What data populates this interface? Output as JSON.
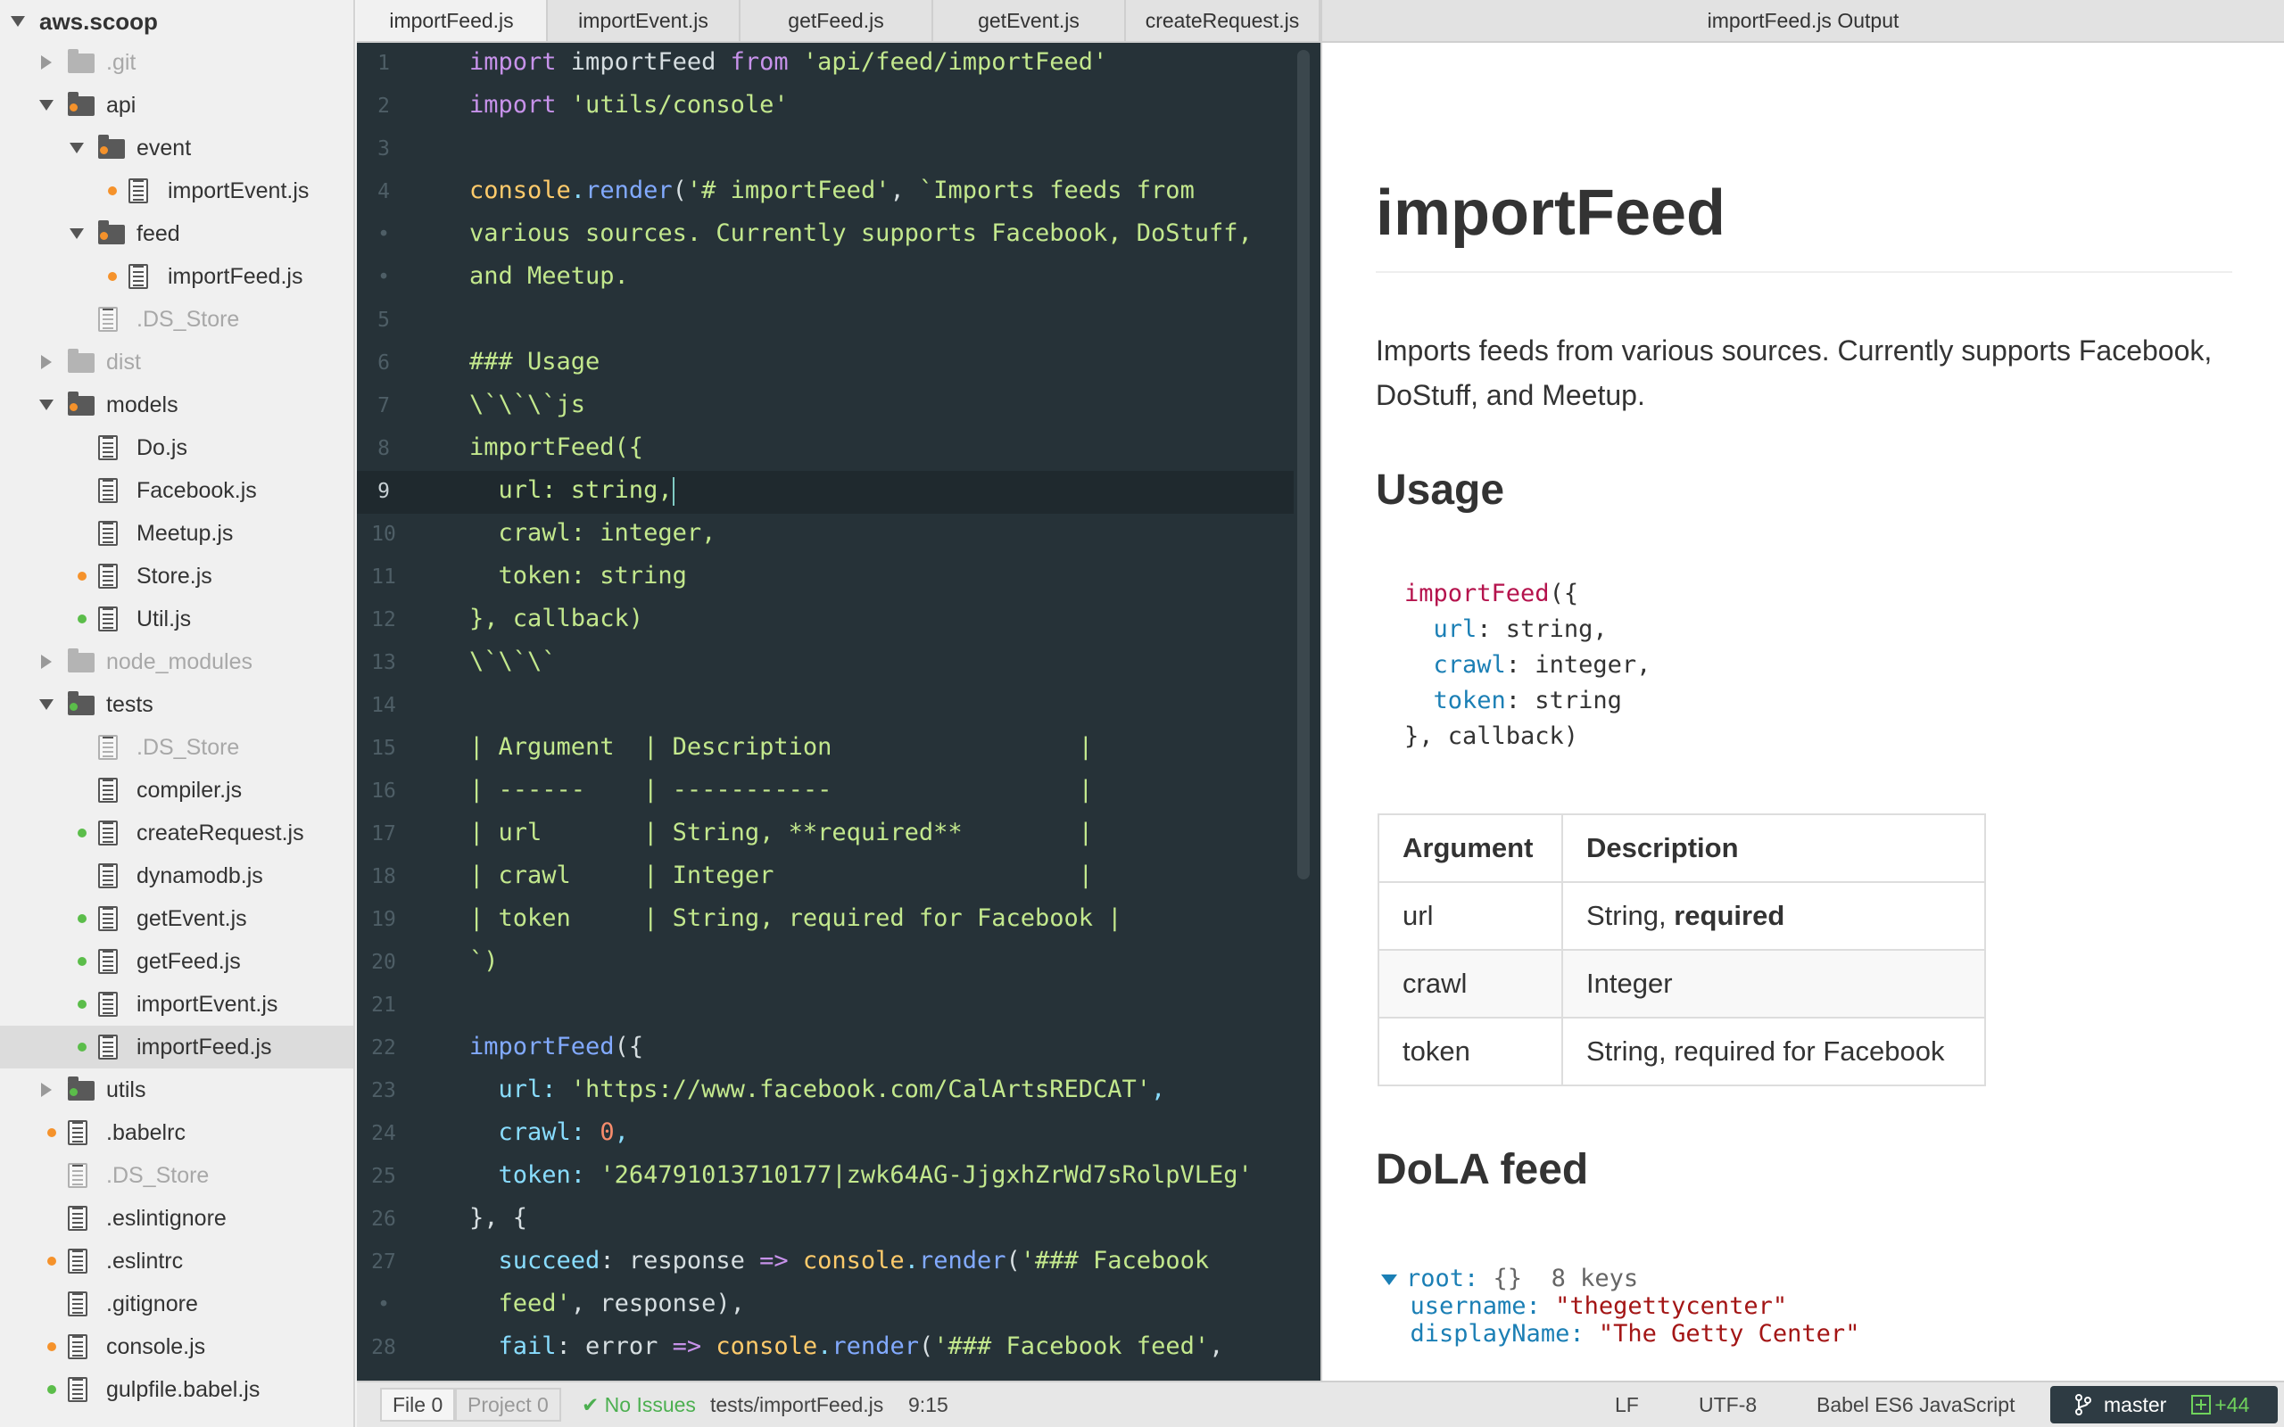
{
  "sidebar": {
    "project": "aws.scoop",
    "items": [
      {
        "label": ".git"
      },
      {
        "label": "api"
      },
      {
        "label": "event"
      },
      {
        "label": "importEvent.js"
      },
      {
        "label": "feed"
      },
      {
        "label": "importFeed.js"
      },
      {
        "label": ".DS_Store"
      },
      {
        "label": "dist"
      },
      {
        "label": "models"
      },
      {
        "label": "Do.js"
      },
      {
        "label": "Facebook.js"
      },
      {
        "label": "Meetup.js"
      },
      {
        "label": "Store.js"
      },
      {
        "label": "Util.js"
      },
      {
        "label": "node_modules"
      },
      {
        "label": "tests"
      },
      {
        "label": ".DS_Store"
      },
      {
        "label": "compiler.js"
      },
      {
        "label": "createRequest.js"
      },
      {
        "label": "dynamodb.js"
      },
      {
        "label": "getEvent.js"
      },
      {
        "label": "getFeed.js"
      },
      {
        "label": "importEvent.js"
      },
      {
        "label": "importFeed.js"
      },
      {
        "label": "utils"
      },
      {
        "label": ".babelrc"
      },
      {
        "label": ".DS_Store"
      },
      {
        "label": ".eslintignore"
      },
      {
        "label": ".eslintrc"
      },
      {
        "label": ".gitignore"
      },
      {
        "label": "console.js"
      },
      {
        "label": "gulpfile.babel.js"
      }
    ]
  },
  "tabs": [
    {
      "label": "importFeed.js"
    },
    {
      "label": "importEvent.js"
    },
    {
      "label": "getFeed.js"
    },
    {
      "label": "getEvent.js"
    },
    {
      "label": "createRequest.js"
    }
  ],
  "output_tab": {
    "label": "importFeed.js Output"
  },
  "editor": {
    "line_numbers": [
      "1",
      "2",
      "3",
      "4",
      "•",
      "•",
      "5",
      "6",
      "7",
      "8",
      "9",
      "10",
      "11",
      "12",
      "13",
      "14",
      "15",
      "16",
      "17",
      "18",
      "19",
      "20",
      "21",
      "22",
      "23",
      "24",
      "25",
      "26",
      "27",
      "•",
      "28"
    ],
    "lines": {
      "l1a": "import",
      "l1b": " importFeed ",
      "l1c": "from",
      "l1d": " 'api/feed/importFeed'",
      "l2a": "import",
      "l2b": " 'utils/console'",
      "l4a": "console",
      "l4b": ".",
      "l4c": "render",
      "l4d": "(",
      "l4e": "'# importFeed'",
      "l4f": ", ",
      "l4g": "`Imports feeds from",
      "l4w1": "various sources. Currently supports Facebook, DoStuff,",
      "l4w2": "and Meetup.",
      "l6": "### Usage",
      "l7": "\\`\\`\\`js",
      "l8": "importFeed({",
      "l9": "  url: string,",
      "l10": "  crawl: integer,",
      "l11": "  token: string",
      "l12": "}, callback)",
      "l13": "\\`\\`\\`",
      "l15": "| Argument  | Description                 |",
      "l16": "| ------    | -----------                 |",
      "l17": "| url       | String, **required**        |",
      "l18": "| crawl     | Integer                     |",
      "l19": "| token     | String, required for Facebook |",
      "l20": "`)",
      "l22a": "importFeed",
      "l22b": "({",
      "l23a": "  url",
      "l23b": ": ",
      "l23c": "'https://www.facebook.com/CalArtsREDCAT'",
      "l23d": ",",
      "l24a": "  crawl",
      "l24b": ": ",
      "l24c": "0",
      "l24d": ",",
      "l25a": "  token",
      "l25b": ": ",
      "l25c": "'264791013710177|zwk64AG-JjgxhZrWd7sRolpVLEg'",
      "l26": "}, {",
      "l27a": "  succeed",
      "l27b": ": response ",
      "l27c": "=>",
      "l27d": " console",
      "l27e": ".",
      "l27f": "render",
      "l27g": "(",
      "l27h": "'### Facebook",
      "l27w1": "  feed'",
      "l27w2": ", response),",
      "l28a": "  fail",
      "l28b": ": error ",
      "l28c": "=>",
      "l28d": " console",
      "l28e": ".",
      "l28f": "render",
      "l28g": "(",
      "l28h": "'### Facebook feed'",
      "l28i": ","
    }
  },
  "output": {
    "title": "importFeed",
    "description": "Imports feeds from various sources. Currently supports Facebook, DoStuff, and Meetup.",
    "usage_heading": "Usage",
    "code": {
      "fn": "importFeed",
      "open": "({",
      "k1": "url",
      "v1": ": string,",
      "k2": "crawl",
      "v2": ": integer,",
      "k3": "token",
      "v3": ": string",
      "close": "}, callback)"
    },
    "table": {
      "headers": [
        "Argument",
        "Description"
      ],
      "rows": [
        [
          "url",
          "String, ",
          "required"
        ],
        [
          "crawl",
          "Integer",
          ""
        ],
        [
          "token",
          "String, required for Facebook",
          ""
        ]
      ]
    },
    "feed_heading": "DoLA feed",
    "json": {
      "root_key": "root:",
      "root_type": " {} ",
      "root_count": " 8 keys",
      "k1": "username:",
      "v1": " \"thegettycenter\"",
      "k2": "displayName:",
      "v2": " \"The Getty Center\""
    }
  },
  "status": {
    "file_tab": "File",
    "file_count": "0",
    "project_tab": "Project",
    "project_count": "0",
    "issues": "✔ No Issues",
    "path": "tests/importFeed.js",
    "cursor": "9:15",
    "line_ending": "LF",
    "encoding": "UTF-8",
    "grammar": "Babel ES6 JavaScript",
    "branch": "master",
    "changes": "+44"
  },
  "colors": {
    "editor_bg": "#263238",
    "keyword": "#c792ea",
    "string": "#c3e88d",
    "function": "#82aaff",
    "modified_dot": "#f5922b",
    "added_dot": "#5bbd4a"
  }
}
